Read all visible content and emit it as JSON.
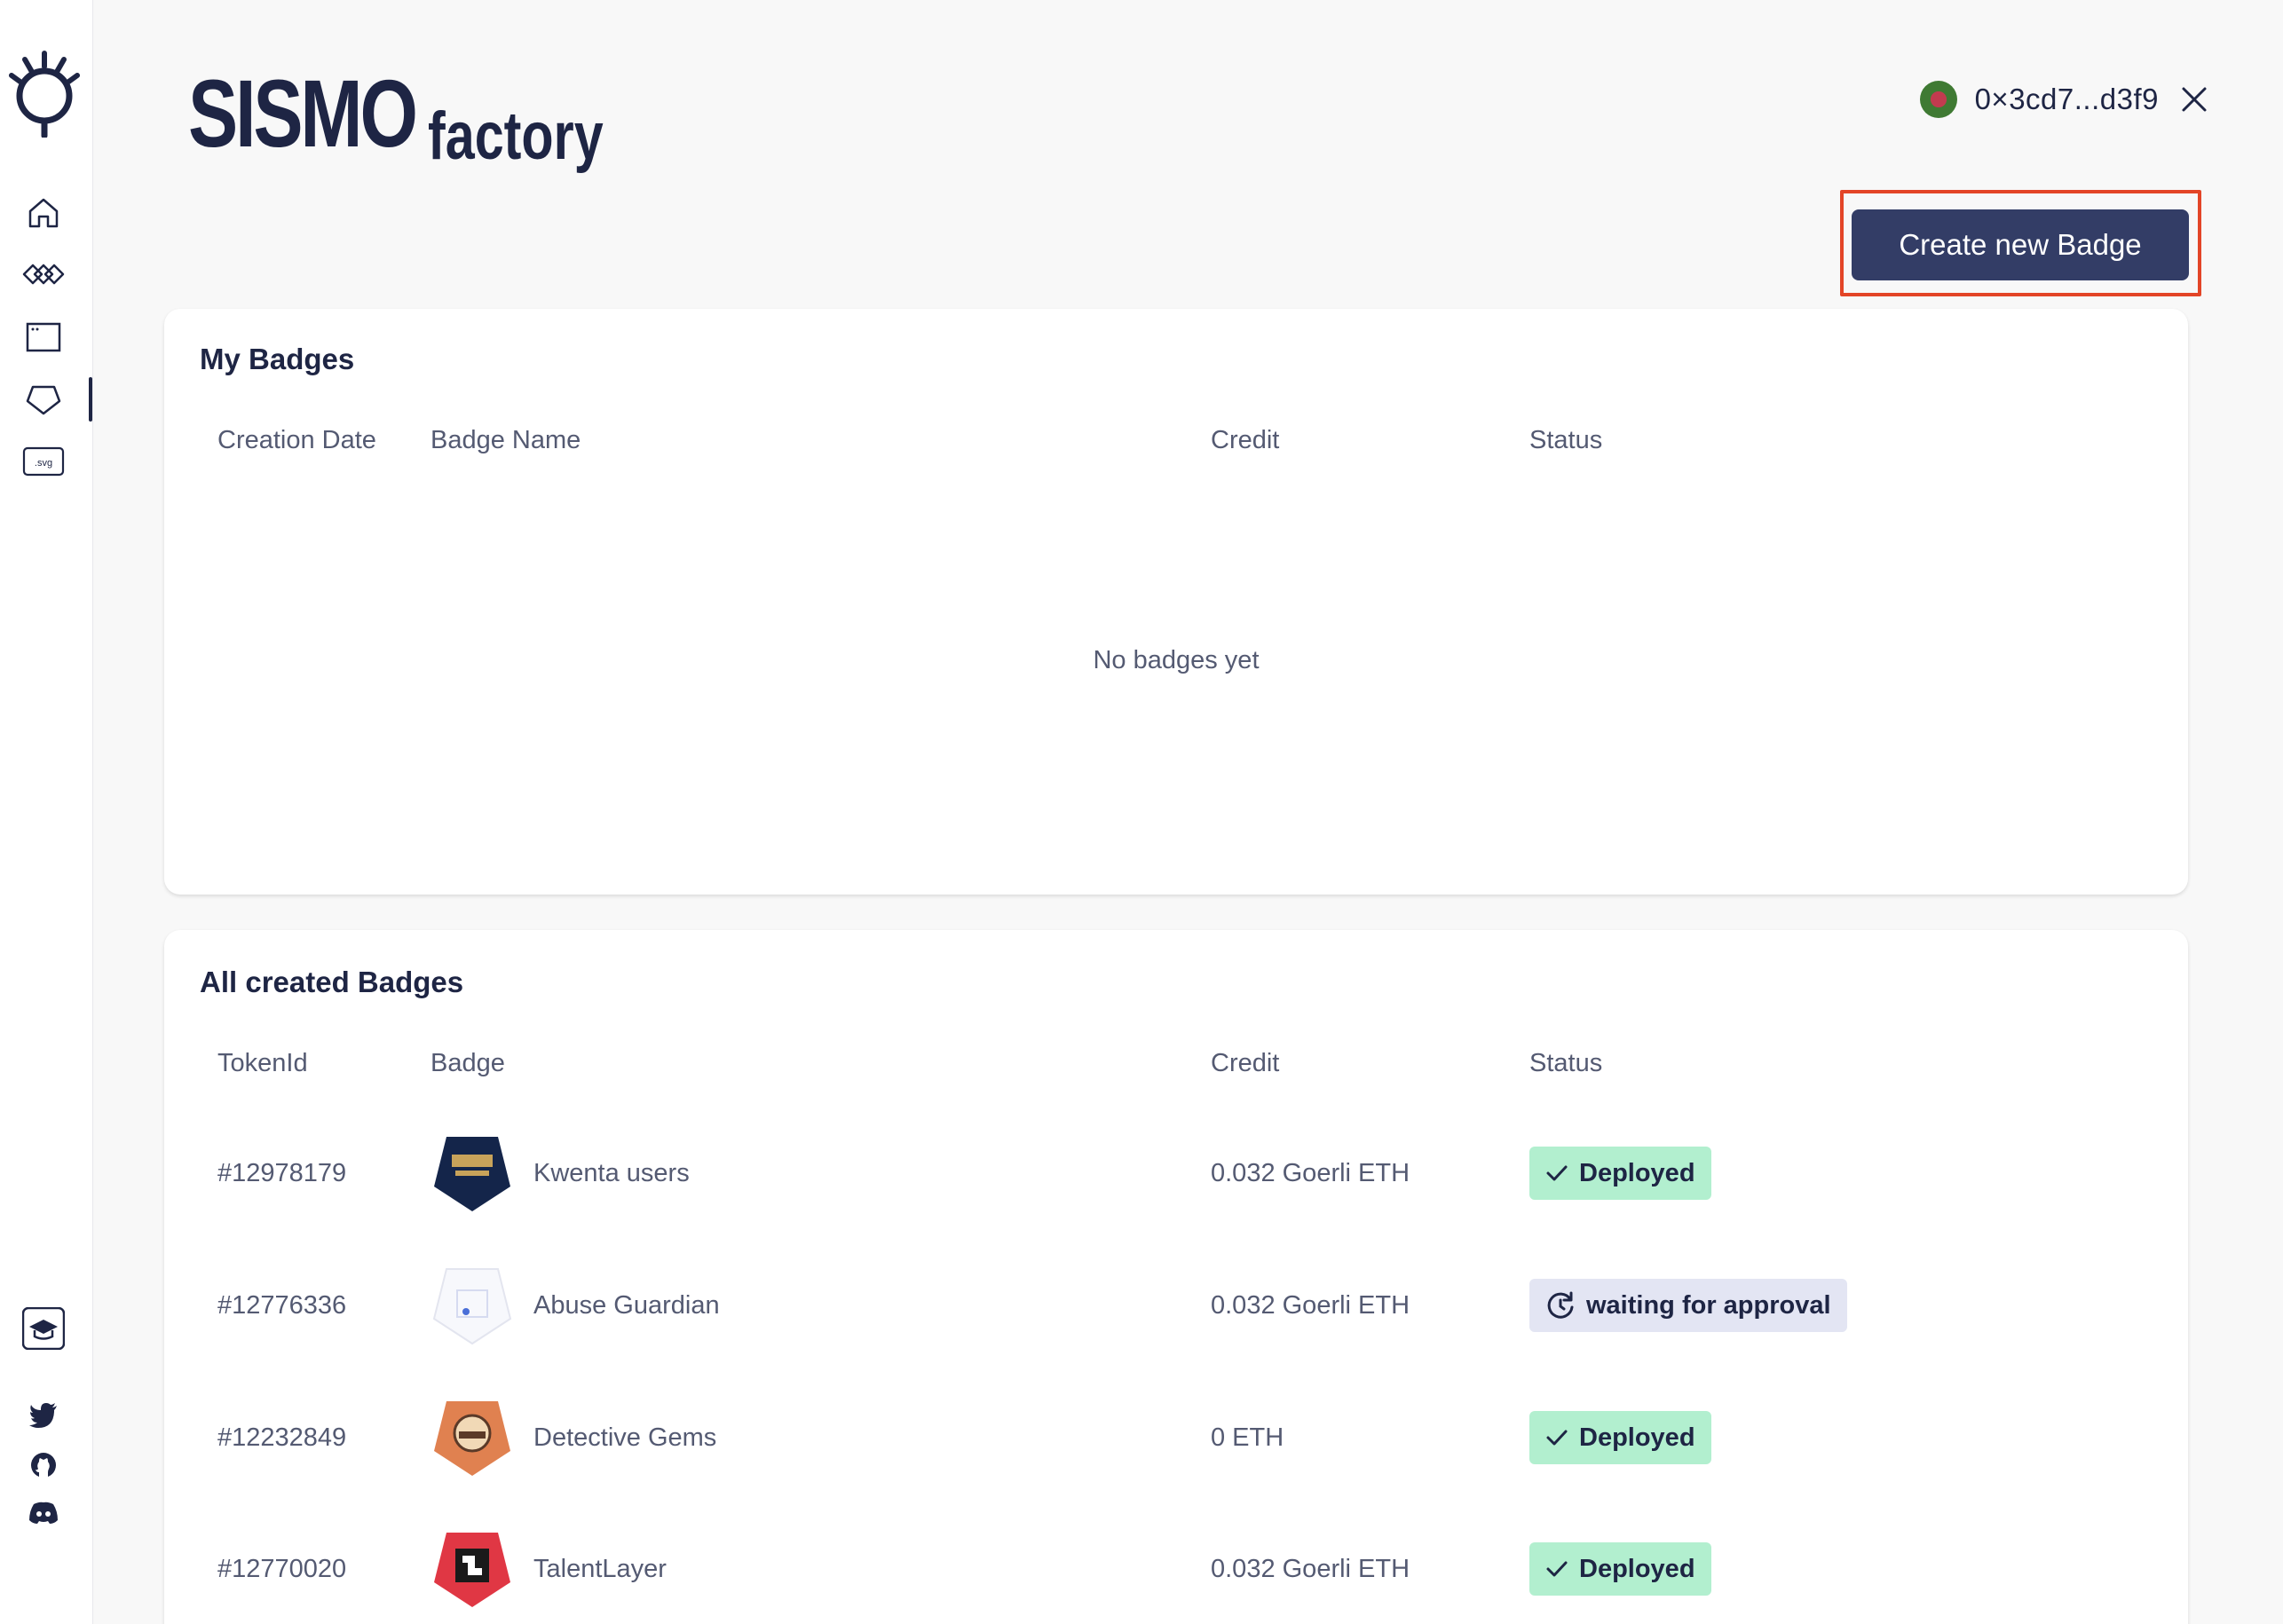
{
  "app": {
    "brand_main": "SISMO",
    "brand_sub": "factory"
  },
  "sidebar": {
    "items": [
      {
        "name": "home",
        "icon": "home-icon"
      },
      {
        "name": "groups",
        "icon": "chain-icon"
      },
      {
        "name": "browser",
        "icon": "window-icon"
      },
      {
        "name": "badges",
        "icon": "badge-icon",
        "active": true
      },
      {
        "name": "svg",
        "icon": "svg-file-icon",
        "label": ".svg"
      }
    ],
    "bottom": [
      {
        "name": "docs",
        "icon": "graduation-cap-icon"
      },
      {
        "name": "twitter",
        "icon": "twitter-icon"
      },
      {
        "name": "github",
        "icon": "github-icon"
      },
      {
        "name": "discord",
        "icon": "discord-icon"
      }
    ]
  },
  "wallet": {
    "address": "0×3cd7...d3f9"
  },
  "actions": {
    "create_badge_label": "Create new Badge"
  },
  "my_badges": {
    "title": "My Badges",
    "columns": [
      "Creation Date",
      "Badge Name",
      "Credit",
      "Status"
    ],
    "empty_text": "No badges yet"
  },
  "all_badges": {
    "title": "All created Badges",
    "columns": [
      "TokenId",
      "Badge",
      "Credit",
      "Status"
    ],
    "rows": [
      {
        "token_id": "#12978179",
        "badge": "Kwenta users",
        "credit": "0.032 Goerli ETH",
        "status": "Deployed",
        "status_type": "deployed",
        "thumb_color": "#14254a"
      },
      {
        "token_id": "#12776336",
        "badge": "Abuse Guardian",
        "credit": "0.032 Goerli ETH",
        "status": "waiting for approval",
        "status_type": "waiting",
        "thumb_color": "#f4f5fb"
      },
      {
        "token_id": "#12232849",
        "badge": "Detective Gems",
        "credit": "0 ETH",
        "status": "Deployed",
        "status_type": "deployed",
        "thumb_color": "#e08150"
      },
      {
        "token_id": "#12770020",
        "badge": "TalentLayer",
        "credit": "0.032 Goerli ETH",
        "status": "Deployed",
        "status_type": "deployed",
        "thumb_color": "#e03744"
      }
    ]
  },
  "colors": {
    "brand_navy": "#1e2544",
    "button_bg": "#333d66",
    "highlight": "#e34527",
    "deployed_bg": "#b2efcf",
    "waiting_bg": "#e3e5f3"
  }
}
